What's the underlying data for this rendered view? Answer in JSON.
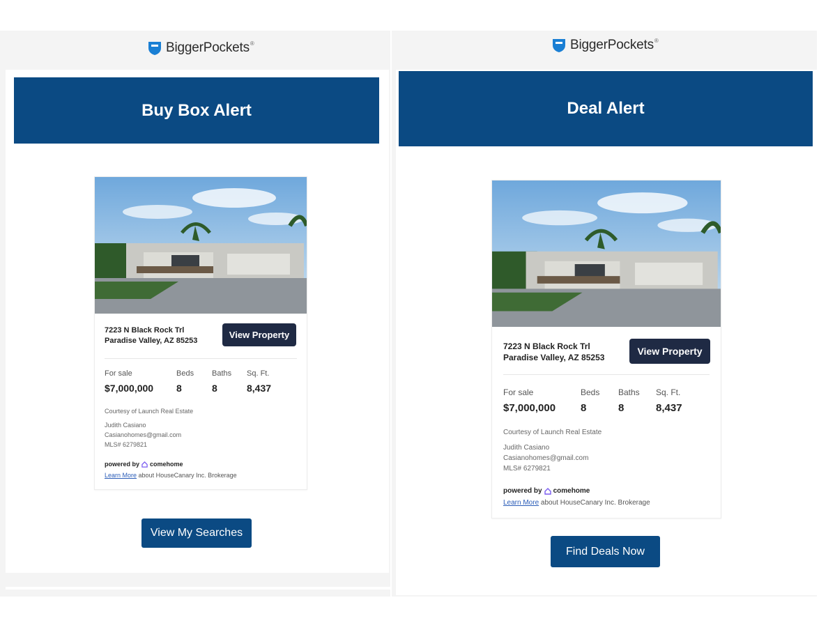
{
  "brand": {
    "name": "BiggerPockets",
    "mark": "®"
  },
  "colors": {
    "brand_blue": "#0b4a83",
    "button_dark": "#1f2a44",
    "link": "#2b5db8"
  },
  "left": {
    "banner_title": "Buy Box Alert",
    "cta_label": "View My Searches"
  },
  "right": {
    "banner_title": "Deal Alert",
    "cta_label": "Find Deals Now"
  },
  "listing": {
    "address_line1": "7223 N Black Rock Trl",
    "address_line2": "Paradise Valley, AZ 85253",
    "view_button": "View Property",
    "status_label": "For sale",
    "price": "$7,000,000",
    "beds_label": "Beds",
    "beds": "8",
    "baths_label": "Baths",
    "baths": "8",
    "sqft_label": "Sq. Ft.",
    "sqft": "8,437",
    "courtesy": "Courtesy of Launch Real Estate",
    "agent_name": "Judith Casiano",
    "agent_email": "Casianohomes@gmail.com",
    "mls": "MLS# 6279821",
    "powered_by": "powered by",
    "powered_brand": "comehome",
    "learn_more": "Learn More",
    "learn_more_suffix": "about HouseCanary Inc. Brokerage"
  }
}
